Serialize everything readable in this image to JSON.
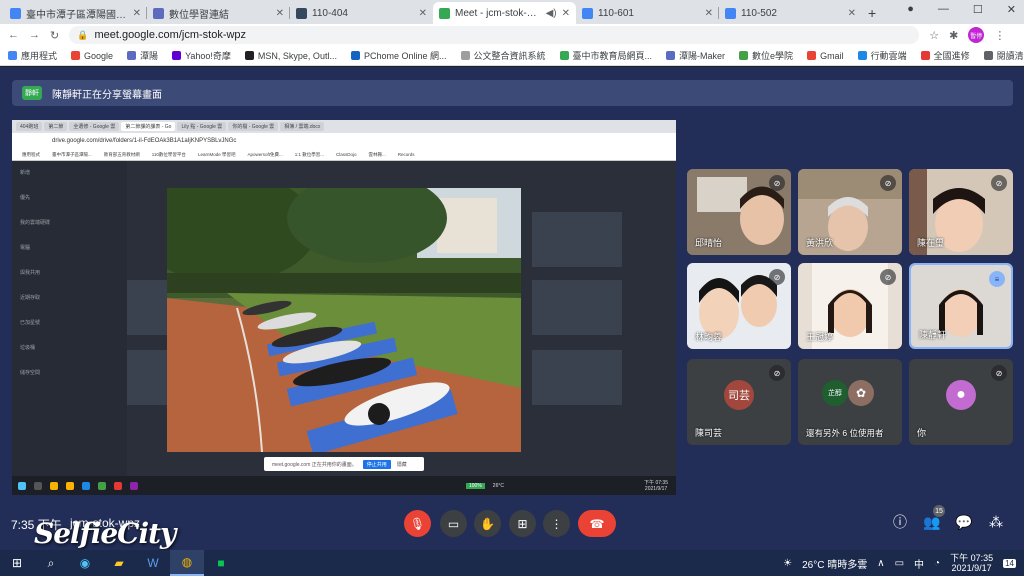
{
  "browser": {
    "tabs": [
      {
        "title": "臺中市潭子區潭陽國民小學",
        "color": "#4285f4",
        "active": false
      },
      {
        "title": "數位學習連結",
        "color": "#5c6bc0",
        "active": false
      },
      {
        "title": "110-404",
        "color": "#34495e",
        "active": false
      },
      {
        "title": "Meet - jcm-stok-wpz",
        "color": "#34a853",
        "active": true
      },
      {
        "title": "110-601",
        "color": "#4285f4",
        "active": false
      },
      {
        "title": "110-502",
        "color": "#4285f4",
        "active": false
      }
    ],
    "new_tab": "+",
    "url": "meet.google.com/jcm-stok-wpz",
    "profile_label": "暫停"
  },
  "bookmarks": [
    {
      "label": "應用程式",
      "color": "#4285f4"
    },
    {
      "label": "Google",
      "color": "#ea4335"
    },
    {
      "label": "潭陽",
      "color": "#5c6bc0"
    },
    {
      "label": "Yahoo!奇摩",
      "color": "#6001d2"
    },
    {
      "label": "MSN, Skype, Outl...",
      "color": "#202124"
    },
    {
      "label": "PChome Online 網...",
      "color": "#1565c0"
    },
    {
      "label": "公文整合資訊系統",
      "color": "#9e9e9e"
    },
    {
      "label": "臺中市教育局網頁...",
      "color": "#34a853"
    },
    {
      "label": "潭陽-Maker",
      "color": "#5c6bc0"
    },
    {
      "label": "數位e學院",
      "color": "#43a047"
    },
    {
      "label": "Gmail",
      "color": "#ea4335"
    },
    {
      "label": "行動雲端",
      "color": "#1e88e5"
    },
    {
      "label": "全國進修",
      "color": "#e53935"
    }
  ],
  "bookmarks_other": "閱讀清單",
  "meet": {
    "presenting_banner": "陳靜軒正在分享螢幕畫面",
    "presenter_pill": "靜軒",
    "shared_screen": {
      "tabs": [
        "404跑班",
        "第二節",
        "全選修 - Google 雲",
        "第二節課的課表 - Go",
        "Lily 點 - Google 雲",
        "你的檔 - Google 雲",
        "相簿 / 雲端.docx"
      ],
      "url": "drive.google.com/drive/folders/1-il-FdEOAk3B1A1aIjKNPYSBLvJNGc",
      "bookmarks": [
        "應用程式",
        "臺中市潭子區潭陽...",
        "教育部五育教材網",
        "110數位學習平台",
        "LearnMode 學習吧",
        "Apowersoft免費...",
        "1:1 數位學習...",
        "ClassDojo",
        "雲林縣...",
        "Records"
      ],
      "side_items": [
        "新增",
        "優先",
        "我的雲端硬碟",
        "電腦",
        "與我共用",
        "近期存取",
        "已加星號",
        "垃圾桶",
        "儲存空間"
      ],
      "toast_text": "meet.google.com 正在共用你的畫面。",
      "toast_button": "停止共用",
      "toast_hide": "隱藏",
      "taskbar_weather": "26°C",
      "taskbar_time": "下午 07:35",
      "taskbar_date": "2021/9/17",
      "battery": "100%"
    },
    "participants": [
      {
        "name": "邱晴怡",
        "muted": true,
        "video": true
      },
      {
        "name": "黃洪欣",
        "muted": true,
        "video": true
      },
      {
        "name": "陳在璽",
        "muted": true,
        "video": true
      },
      {
        "name": "林昀蓉",
        "muted": true,
        "video": true
      },
      {
        "name": "王冠婷",
        "muted": true,
        "video": true
      },
      {
        "name": "陳靜軒",
        "muted": false,
        "video": true
      },
      {
        "name": "陳司芸",
        "muted": true,
        "video": false,
        "avatar_text": "司芸",
        "avatar_color": "#a1473d"
      },
      {
        "name": "還有另外 6 位使用者",
        "muted": false,
        "video": false,
        "avatar_text": "芷醇",
        "avatar_color": "#1e5e2f"
      },
      {
        "name": "你",
        "muted": true,
        "video": false,
        "avatar_text": "",
        "avatar_color": "#c26bd1"
      }
    ],
    "bottom_bar": {
      "time": "7:35 下午",
      "meeting_code": "jcm-stok-wpz",
      "participant_count": "15"
    },
    "accent_red": "#ea4335"
  },
  "watermark": "SelfieCity",
  "windows_taskbar": {
    "weather": "26°C 晴時多雲",
    "ime": "中",
    "time": "下午 07:35",
    "date": "2021/9/17",
    "notifications": "14"
  }
}
